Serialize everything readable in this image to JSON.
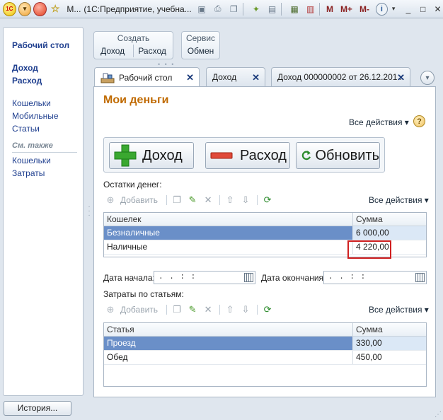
{
  "titlebar": {
    "app_short": "М...",
    "title": "(1С:Предприятие, учебна...",
    "mem_m": "M",
    "mem_mplus": "M+",
    "mem_mminus": "M-",
    "info": "i"
  },
  "leftpanel": {
    "desktop": "Рабочий стол",
    "income": "Доход",
    "expense": "Расход",
    "wallets": "Кошельки",
    "mobile": "Мобильные",
    "articles": "Статьи",
    "see_also": "См. также",
    "see_wallets": "Кошельки",
    "see_costs": "Затраты"
  },
  "cmdpanel": {
    "create": {
      "title": "Создать",
      "items": [
        "Доход",
        "Расход"
      ]
    },
    "service": {
      "title": "Сервис",
      "items": [
        "Обмен"
      ]
    }
  },
  "tabs": [
    {
      "label": "Рабочий стол"
    },
    {
      "label": "Доход"
    },
    {
      "label": "Доход 000000002 от 26.12.201..."
    }
  ],
  "form": {
    "title": "Мои деньги",
    "all_actions": "Все действия",
    "help": "?",
    "buttons": {
      "income": "Доход",
      "expense": "Расход",
      "refresh": "Обновить"
    },
    "balances_label": "Остатки денег:",
    "add_label": "Добавить",
    "balances": {
      "columns": [
        "Кошелек",
        "Сумма"
      ],
      "rows": [
        {
          "name": "Безналичные",
          "amount": "6 000,00"
        },
        {
          "name": "Наличные",
          "amount": "4 220,00"
        }
      ]
    },
    "date_start_label": "Дата начала:",
    "date_start_value": ". .     : :",
    "date_end_label": "Дата окончания:",
    "date_end_value": ". .     : :",
    "costs_label": "Затраты по статьям:",
    "costs": {
      "columns": [
        "Статья",
        "Сумма"
      ],
      "rows": [
        {
          "name": "Проезд",
          "amount": "330,00"
        },
        {
          "name": "Обед",
          "amount": "450,00"
        }
      ]
    }
  },
  "statusbar": {
    "history": "История..."
  },
  "colors": {
    "accent_title": "#c06a00",
    "selection": "#6a8fc8",
    "highlight": "#d02020",
    "link": "#1f3f8f"
  }
}
